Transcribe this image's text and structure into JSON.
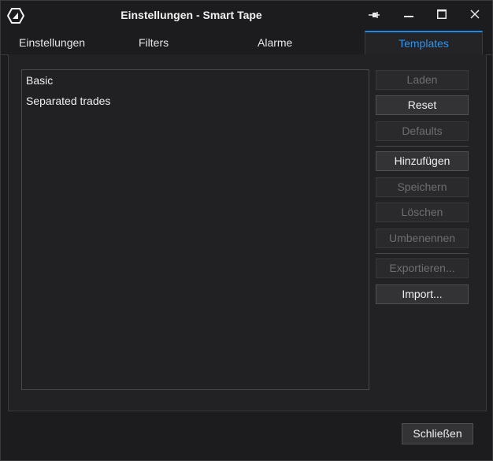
{
  "window": {
    "title": "Einstellungen - Smart Tape",
    "logo_icon": "app-logo-icon",
    "controls": [
      "pin-icon",
      "minimize-icon",
      "maximize-icon",
      "close-icon"
    ]
  },
  "tabs": [
    {
      "label": "Einstellungen",
      "active": false
    },
    {
      "label": "Filters",
      "active": false
    },
    {
      "label": "Alarme",
      "active": false
    },
    {
      "label": "Templates",
      "active": true
    }
  ],
  "templates": {
    "items": [
      "Basic",
      "Separated trades"
    ]
  },
  "buttons": {
    "laden": "Laden",
    "reset": "Reset",
    "defaults": "Defaults",
    "hinzufuegen": "Hinzufügen",
    "speichern": "Speichern",
    "loeschen": "Löschen",
    "umbenennen": "Umbenennen",
    "exportieren": "Exportieren...",
    "import": "Import..."
  },
  "footer": {
    "close_label": "Schließen"
  },
  "colors": {
    "accent": "#1e88e5",
    "background": "#1c1c1e",
    "panel": "#222224"
  }
}
